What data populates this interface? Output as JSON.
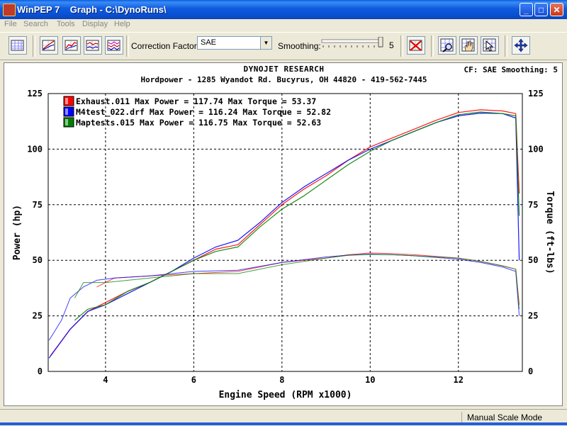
{
  "window": {
    "title": "WinPEP 7    Graph - C:\\DynoRuns\\"
  },
  "window_buttons": {
    "minimize": "_",
    "maximize": "□",
    "close": "✕"
  },
  "menu": [
    "File",
    "Search",
    "Tools",
    "Display",
    "Help"
  ],
  "toolbar": {
    "correction_label": "Correction Factor:",
    "correction_value": "SAE",
    "smoothing_label": "Smoothing:",
    "smoothing_value": "5",
    "smoothing_level": 5
  },
  "graph_header": {
    "company": "DYNOJET RESEARCH",
    "address": "Hordpower - 1285 Wyandot Rd. Bucyrus, OH  44820 - 419-562-7445",
    "cf_text": "CF: SAE  Smoothing: 5"
  },
  "status": {
    "mode": "Manual Scale Mode"
  },
  "chart_data": {
    "type": "line",
    "xlabel": "Engine Speed (RPM x1000)",
    "ylabel_left": "Power (hp)",
    "ylabel_right": "Torque (ft-lbs)",
    "xlim": [
      2.7,
      13.45
    ],
    "ylim": [
      0,
      125
    ],
    "x_ticks": [
      "4",
      "6",
      "8",
      "10",
      "12"
    ],
    "x_tick_values": [
      4,
      6,
      8,
      10,
      12
    ],
    "y_ticks": [
      "0",
      "25",
      "50",
      "75",
      "100",
      "125"
    ],
    "y_tick_values": [
      0,
      25,
      50,
      75,
      100,
      125
    ],
    "grid": true,
    "legend_position": "top-left",
    "series": [
      {
        "name": "Exhaust.011",
        "legend": "Exhaust.011 Max Power = 117.74 Max Torque = 53.37",
        "color": "#ff0000",
        "power": [
          [
            2.75,
            7
          ],
          [
            3.2,
            19
          ],
          [
            3.6,
            27
          ],
          [
            4.0,
            31
          ],
          [
            4.5,
            36
          ],
          [
            5.0,
            40
          ],
          [
            5.5,
            45
          ],
          [
            6.0,
            50
          ],
          [
            6.5,
            55
          ],
          [
            7.0,
            57
          ],
          [
            7.5,
            66
          ],
          [
            8.0,
            75
          ],
          [
            8.5,
            82
          ],
          [
            9.0,
            88
          ],
          [
            9.5,
            95
          ],
          [
            10.0,
            101
          ],
          [
            10.5,
            105
          ],
          [
            11.0,
            109
          ],
          [
            11.5,
            113
          ],
          [
            12.0,
            116.5
          ],
          [
            12.5,
            117.7
          ],
          [
            13.0,
            117.2
          ],
          [
            13.3,
            116
          ],
          [
            13.38,
            80
          ]
        ],
        "torque": [
          [
            3.8,
            38
          ],
          [
            4.2,
            42
          ],
          [
            5.0,
            43
          ],
          [
            6.0,
            44
          ],
          [
            7.0,
            45
          ],
          [
            8.0,
            49
          ],
          [
            9.0,
            51
          ],
          [
            9.5,
            52.5
          ],
          [
            10.0,
            53.3
          ],
          [
            10.5,
            53
          ],
          [
            11.0,
            52.5
          ],
          [
            12.0,
            51
          ],
          [
            12.5,
            49.5
          ],
          [
            13.0,
            47.5
          ],
          [
            13.3,
            46
          ],
          [
            13.38,
            30
          ]
        ]
      },
      {
        "name": "M4test_022.drf",
        "legend": "M4test_022.drf Max Power = 116.24 Max Torque = 52.82",
        "color": "#0000ff",
        "power": [
          [
            2.72,
            6
          ],
          [
            3.2,
            19
          ],
          [
            3.6,
            27
          ],
          [
            4.0,
            30
          ],
          [
            4.5,
            35
          ],
          [
            5.0,
            40
          ],
          [
            5.5,
            45
          ],
          [
            6.0,
            51
          ],
          [
            6.5,
            56
          ],
          [
            7.0,
            59
          ],
          [
            7.5,
            67
          ],
          [
            8.0,
            76
          ],
          [
            8.5,
            83
          ],
          [
            9.0,
            89
          ],
          [
            9.5,
            95
          ],
          [
            10.0,
            100
          ],
          [
            10.5,
            104
          ],
          [
            11.0,
            108
          ],
          [
            11.5,
            112
          ],
          [
            12.0,
            115
          ],
          [
            12.5,
            116.2
          ],
          [
            13.0,
            116
          ],
          [
            13.3,
            114
          ],
          [
            13.38,
            50
          ]
        ],
        "torque": [
          [
            2.72,
            14
          ],
          [
            3.0,
            23
          ],
          [
            3.2,
            33
          ],
          [
            3.5,
            38
          ],
          [
            3.8,
            41
          ],
          [
            4.2,
            42
          ],
          [
            5.0,
            43
          ],
          [
            6.0,
            45
          ],
          [
            7.0,
            45.5
          ],
          [
            8.0,
            49
          ],
          [
            9.0,
            51.5
          ],
          [
            9.5,
            52.3
          ],
          [
            10.0,
            52.8
          ],
          [
            10.5,
            52.5
          ],
          [
            11.0,
            52
          ],
          [
            12.0,
            50.5
          ],
          [
            12.5,
            49
          ],
          [
            13.0,
            47
          ],
          [
            13.3,
            45
          ],
          [
            13.38,
            25
          ]
        ]
      },
      {
        "name": "Maptests.015",
        "legend": "Maptests.015 Max Power = 116.75 Max Torque = 52.63",
        "color": "#008000",
        "power": [
          [
            3.3,
            23
          ],
          [
            3.6,
            28
          ],
          [
            4.0,
            30
          ],
          [
            4.5,
            36
          ],
          [
            5.0,
            40
          ],
          [
            5.5,
            45
          ],
          [
            6.0,
            50
          ],
          [
            6.5,
            54
          ],
          [
            7.0,
            56
          ],
          [
            7.5,
            65
          ],
          [
            8.0,
            73
          ],
          [
            8.5,
            79
          ],
          [
            9.0,
            86
          ],
          [
            9.5,
            93
          ],
          [
            10.0,
            99
          ],
          [
            10.5,
            104
          ],
          [
            11.0,
            108
          ],
          [
            11.5,
            112
          ],
          [
            12.0,
            115.5
          ],
          [
            12.5,
            116.7
          ],
          [
            13.0,
            116
          ],
          [
            13.3,
            115
          ],
          [
            13.38,
            70
          ]
        ],
        "torque": [
          [
            3.3,
            33
          ],
          [
            3.5,
            40
          ],
          [
            4.0,
            40
          ],
          [
            5.0,
            42
          ],
          [
            6.0,
            44
          ],
          [
            7.0,
            44
          ],
          [
            8.0,
            48
          ],
          [
            9.0,
            51
          ],
          [
            9.5,
            52.2
          ],
          [
            10.0,
            52.6
          ],
          [
            10.5,
            52.5
          ],
          [
            11.0,
            52
          ],
          [
            12.0,
            51
          ],
          [
            12.5,
            49.5
          ],
          [
            13.0,
            47.5
          ],
          [
            13.3,
            46
          ],
          [
            13.38,
            28
          ]
        ]
      }
    ]
  }
}
